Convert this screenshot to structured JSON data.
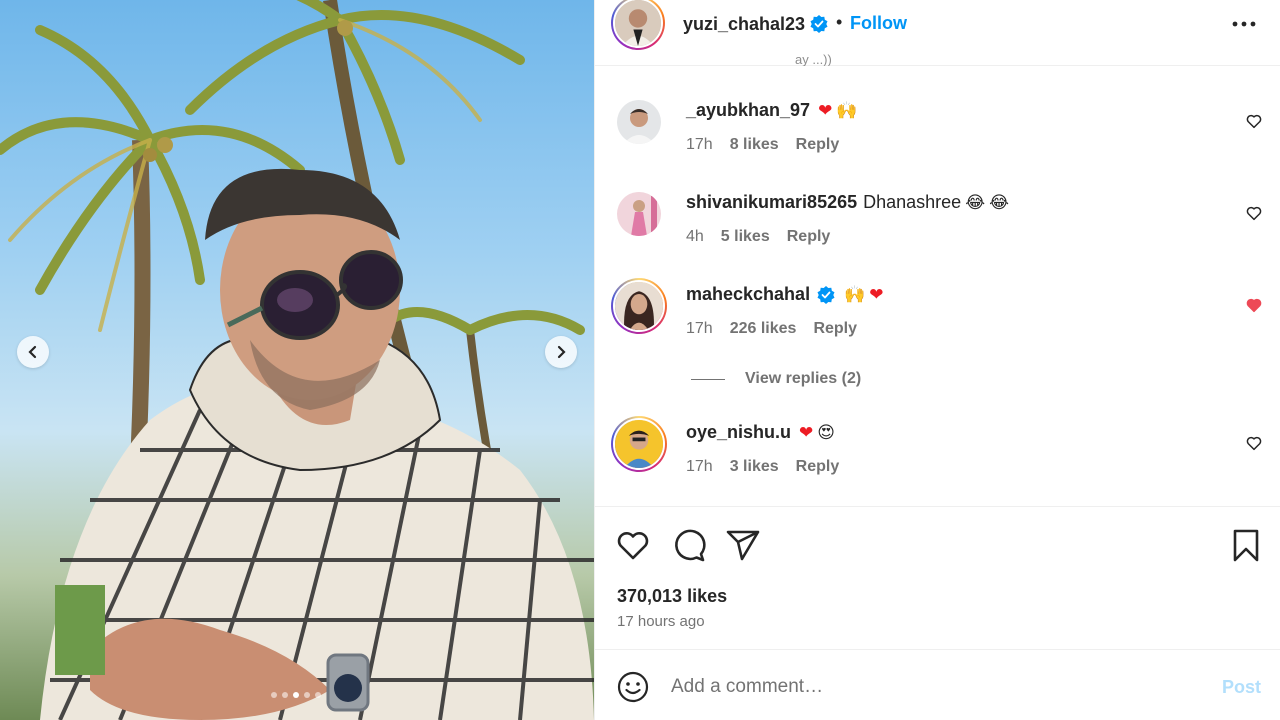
{
  "post": {
    "author": "yuzi_chahal23",
    "verified": true,
    "separator": "•",
    "follow_label": "Follow",
    "more_icon": "more-horizontal-icon",
    "carousel": {
      "total": 5,
      "active_index": 2
    }
  },
  "truncated_caption_tail": "ay ...))",
  "comments": [
    {
      "username": "_ayubkhan_97",
      "verified": false,
      "text": "",
      "emojis": [
        "❤",
        "🙌"
      ],
      "time": "17h",
      "likes": "8 likes",
      "reply_label": "Reply",
      "liked": false,
      "story_ring": false
    },
    {
      "username": "shivanikumari85265",
      "verified": false,
      "text": "Dhanashree",
      "emojis": [
        "😂",
        "😂"
      ],
      "time": "4h",
      "likes": "5 likes",
      "reply_label": "Reply",
      "liked": false,
      "story_ring": false
    },
    {
      "username": "maheckchahal",
      "verified": true,
      "text": "",
      "emojis": [
        "🙌",
        "❤"
      ],
      "time": "17h",
      "likes": "226 likes",
      "reply_label": "Reply",
      "liked": true,
      "story_ring": true
    },
    {
      "username": "oye_nishu.u",
      "verified": false,
      "text": "",
      "emojis": [
        "❤",
        "😍"
      ],
      "time": "17h",
      "likes": "3 likes",
      "reply_label": "Reply",
      "liked": false,
      "story_ring": true
    }
  ],
  "view_replies_label": "View replies (2)",
  "actions": {
    "like_icon": "heart-icon",
    "comment_icon": "comment-icon",
    "share_icon": "share-icon",
    "save_icon": "bookmark-icon"
  },
  "likes_count": "370,013 likes",
  "posted_ago": "17 hours ago",
  "add_comment": {
    "placeholder": "Add a comment…",
    "value": "",
    "post_label": "Post",
    "emoji_icon": "smiley-icon"
  },
  "colors": {
    "accent": "#0095f6",
    "liked_heart": "#ed4956",
    "post_disabled": "#b2dffc",
    "muted_text": "#737373"
  }
}
